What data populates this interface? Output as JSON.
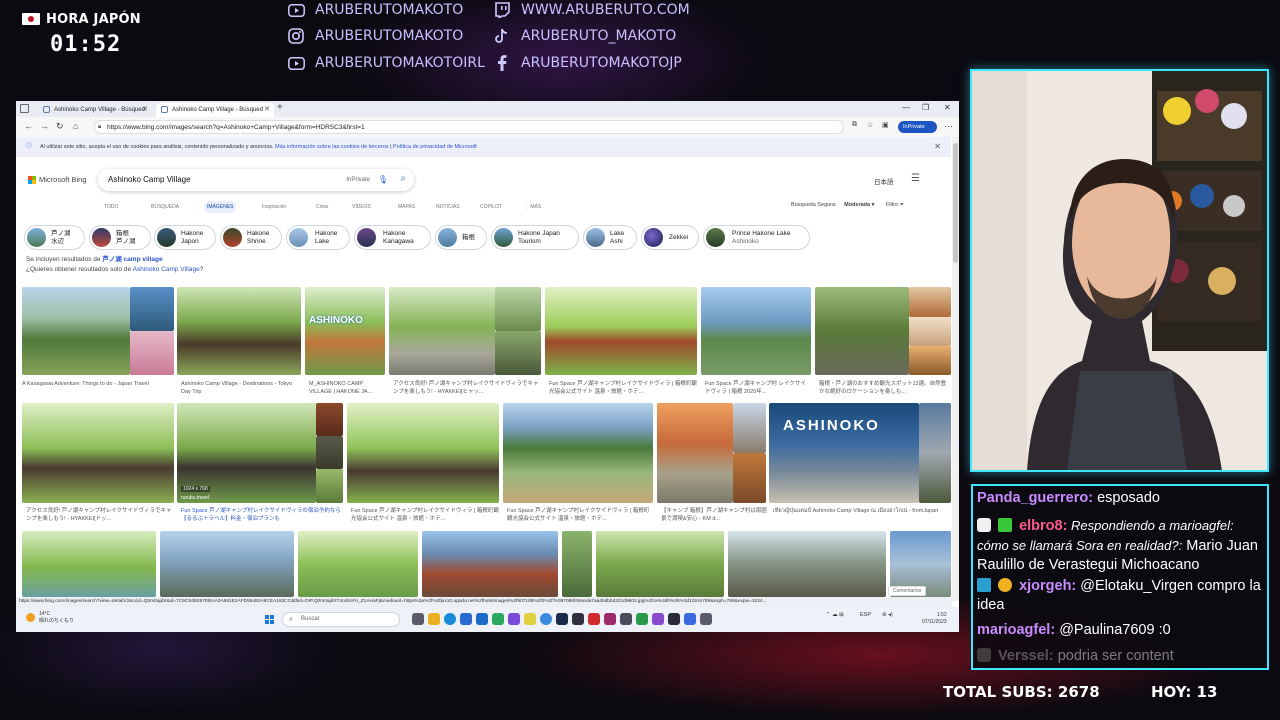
{
  "overlay": {
    "clock_label": "HORA JAPÓN",
    "clock_time": "01:52",
    "socials": [
      {
        "icon": "youtube-icon",
        "text": "ARUBERUTOMAKOTO"
      },
      {
        "icon": "twitch-icon",
        "text": "WWW.ARUBERUTO.COM"
      },
      {
        "icon": "instagram-icon",
        "text": "ARUBERUTOMAKOTO"
      },
      {
        "icon": "tiktok-icon",
        "text": "ARUBERUTO_MAKOTO"
      },
      {
        "icon": "youtube-icon",
        "text": "ARUBERUTOMAKOTOIRL"
      },
      {
        "icon": "facebook-icon",
        "text": "ARUBERUTOMAKOTOJP"
      }
    ],
    "total_subs": "TOTAL SUBS: 2678",
    "hoy": "HOY: 13"
  },
  "browser": {
    "tabs": [
      "Ashinoko Camp Village - Búsqued",
      "Ashinoko Camp Village - Búsqued"
    ],
    "url": "https://www.bing.com/images/search?q=Ashinoko+Camp+Village&form=HDRSC3&first=1",
    "inprivate": "InPrivate",
    "cookie_text": "Al utilizar este sitio, acepta el uso de cookies para análisis, contenido personalizado y anuncios.",
    "cookie_link1": "Más información sobre las cookies de terceros",
    "cookie_sep": "|",
    "cookie_link2": "Política de privacidad de Microsoft",
    "bing_logo": "Microsoft Bing",
    "search_value": "Ashinoko Camp Village",
    "search_inprivate": "InPrivate",
    "lang": "日本語",
    "scopes": [
      "TODO",
      "BÚSQUEDA",
      "IMÁGENES",
      "Inspiración",
      "Crear",
      "VÍDEOS",
      "MAPAS",
      "NOTICIAS",
      "COPILOT",
      "⋮ MÁS"
    ],
    "safe_search": "Búsqueda Segura:",
    "safe_value": "Moderada ▾",
    "filter": "Filtro",
    "chips": [
      {
        "l1": "芦ノ湖",
        "l2": "水辺"
      },
      {
        "l1": "箱根",
        "l2": "芦ノ湖"
      },
      {
        "l1": "Hakone",
        "l2": "Japon"
      },
      {
        "l1": "Hakone",
        "l2": "Shrine"
      },
      {
        "l1": "Hakone",
        "l2": "Lake"
      },
      {
        "l1": "Hakone",
        "l2": "Kanagawa"
      },
      {
        "l1": "箱根",
        "l2": ""
      },
      {
        "l1": "Hakone Japan",
        "l2": "Tourism"
      },
      {
        "l1": "Lake",
        "l2": "Ashi"
      },
      {
        "l1": "Zekkei",
        "l2": ""
      },
      {
        "l1": "Prince Hakone Lake",
        "l2": "Ashinoko"
      }
    ],
    "included_prefix": "Se incluyen resultados de ",
    "included_term": "芦ノ湖 camp village",
    "included_q_prefix": "¿Quieres obtener resultados solo de ",
    "included_q_link": "Ashinoko Camp Village",
    "included_q_suffix": "?",
    "captions_row1": [
      "A Kanagawa Adventure: Things to do - Japan Travel",
      "Ashinoko Camp Village - Destinations - Tokyo Day Trip",
      "M_ASHINOKO CAMP VILLAGE | HAKONE JA...",
      "アクセス良好! 芦ノ湖キャンプ村レイクサイドヴィラでキャンプを楽しもう! - HYAKKEI[ヒャッ...",
      "Fun Space 芦ノ湖キャンプ村レイクサイドヴィラ | 箱根町観光協会公式サイト 温泉・旅館・ホテ...",
      "Fun Space 芦ノ湖キャンプ村 レイクサイドヴィラ | 箱根 2020年...",
      "箱根・芦ノ湖のおすすめ観光スポット13選。自然豊かな絶好のロケーションを楽しも..."
    ],
    "captions_row2": [
      "アクセス良好! 芦ノ湖キャンプ村レイクサイドヴィラでキャンプを楽しもう! - HYAKKEI[ドッ...",
      "Fun Space 芦ノ湖キャンプ村レイクサイドヴィラの宿泊予約なら【るるぶトラベル】料金・宿泊プランも",
      "Fun Space 芦ノ湖キャンプ村レイクサイドヴィラ | 箱根町観光協会公式サイト 温泉・旅館・ホテ...",
      "Fun Space 芦ノ湖キャンプ村レイクサイドヴィラ | 箱根町観光協会公式サイト 温泉・旅館・ホテ...",
      "【キャンプ 箱根】芦ノ湖キャンプ村は周囲景で満喫&安心 - KM d...",
      "เที่ยวญี่ปุ่นแคมป์ Ashinoko Camp Village ณ เมืองฮาโกเน่ - fromJapan"
    ],
    "thumb_label": "1024 x 768",
    "thumb_source": "rurubu.travel",
    "feedback": "Comentarios",
    "status_url": "https://www.bing.com/images/search?view=detailV2&ccid=Q0m0ajdX&id=7C9C845E67EBAA3A661E2AFD55482A9CEA183CC&thid=OIP.Q0m0ajdXT4oi2mFo_Z1AHaFj&mediaurl=https%3a%2f%2fpix10.agoda.net%2fhotelImages%2f907188%2f0%2f7e397068f464eda7aa4bdbbd321d9602.jpg%3fca%3d0%26%3d1024x768&exph=768&expw=1024..."
  },
  "taskbar": {
    "weather_temp": "14°C",
    "weather_desc": "晴れのちくもり",
    "search_placeholder": "Buscar",
    "lang": "ESP",
    "time": "1:52",
    "date": "07/11/2023"
  },
  "chat": [
    {
      "user": "Panda_guerrero:",
      "text": " esposado",
      "color": "#c98bff"
    },
    {
      "user": "elbro8:",
      "text": " Respondiendo a marioagfel: cómo se llamará Sora en realidad?:",
      "text2": " Mario Juan Raulillo de Verastegui Michoacano",
      "color": "#ff5a8a"
    },
    {
      "user": "xjorgeh:",
      "text": " @Elotaku_Virgen compro la idea",
      "color": "#c98bff"
    },
    {
      "user": "marioagfel:",
      "text": " @Paulina7609 :0",
      "color": "#c98bff"
    },
    {
      "user": "Verssel:",
      "text": " podria ser content",
      "color": "#888888"
    }
  ]
}
